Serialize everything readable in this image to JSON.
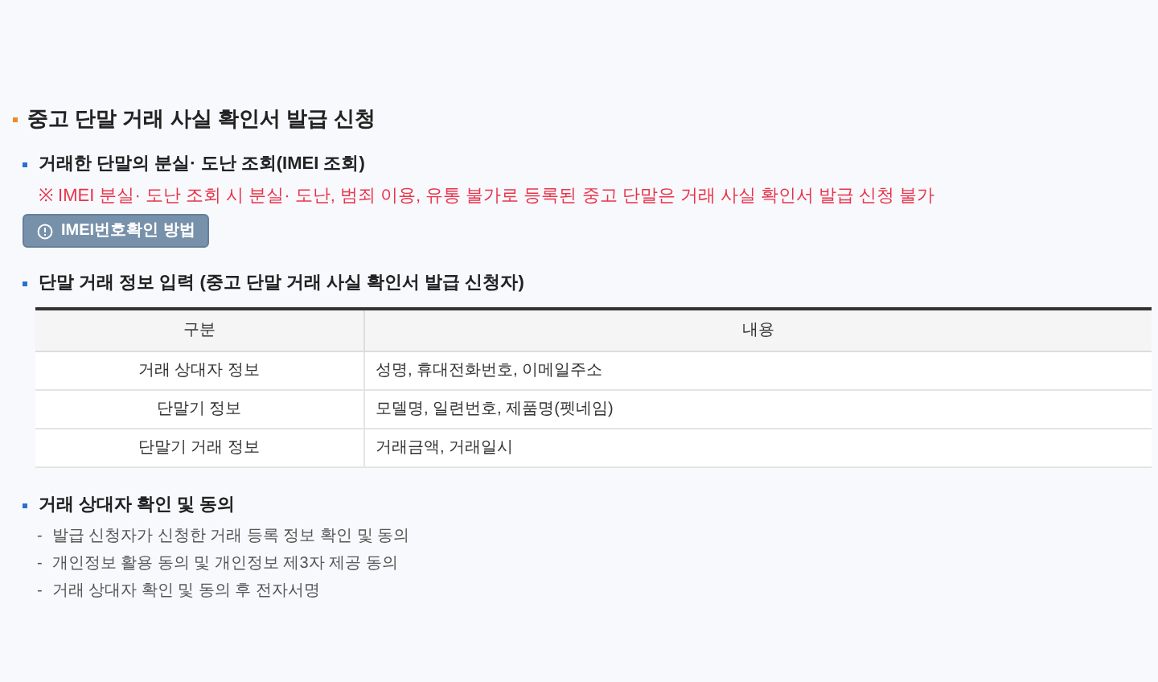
{
  "title": "중고 단말 거래 사실 확인서 발급 신청",
  "sections": [
    {
      "kind": "lookup",
      "heading": "거래한 단말의 분실· 도난 조회(IMEI 조회)",
      "warning": "※ IMEI 분실· 도난 조회 시 분실· 도난, 범죄 이용, 유통 불가로 등록된 중고 단말은 거래 사실 확인서 발급 신청 불가",
      "button": "IMEI번호확인 방법"
    },
    {
      "kind": "table",
      "heading": "단말 거래 정보 입력 (중고 단말 거래 사실 확인서 발급 신청자)",
      "table": {
        "columns": [
          "구분",
          "내용"
        ],
        "rows": [
          [
            "거래 상대자 정보",
            "성명, 휴대전화번호, 이메일주소"
          ],
          [
            "단말기 정보",
            "모델명, 일련번호, 제품명(펫네임)"
          ],
          [
            "단말기 거래 정보",
            "거래금액, 거래일시"
          ]
        ]
      }
    },
    {
      "kind": "list",
      "heading": "거래 상대자 확인 및 동의",
      "items": [
        "발급 신청자가 신청한 거래 등록 정보 확인 및 동의",
        "개인정보 활용 동의 및 개인정보 제3자 제공 동의",
        "거래 상대자 확인 및 동의 후 전자서명"
      ],
      "marker": "-"
    }
  ]
}
